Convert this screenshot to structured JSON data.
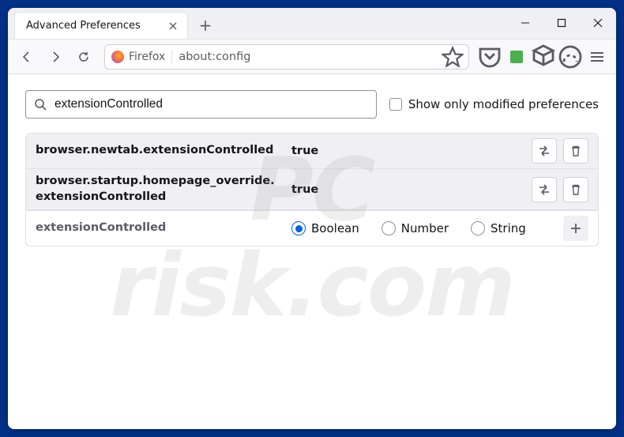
{
  "titlebar": {
    "tab_label": "Advanced Preferences"
  },
  "navbar": {
    "identity_label": "Firefox",
    "url": "about:config"
  },
  "config": {
    "search_value": "extensionControlled",
    "modified_only_label": "Show only modified preferences",
    "rows": [
      {
        "name": "browser.newtab.extensionControlled",
        "value": "true"
      },
      {
        "name": "browser.startup.homepage_override.extensionControlled",
        "value": "true"
      }
    ],
    "new_pref": {
      "name": "extensionControlled",
      "types": [
        "Boolean",
        "Number",
        "String"
      ],
      "selected": "Boolean"
    }
  },
  "watermark": {
    "line1": "PC",
    "line2": "risk.com"
  }
}
